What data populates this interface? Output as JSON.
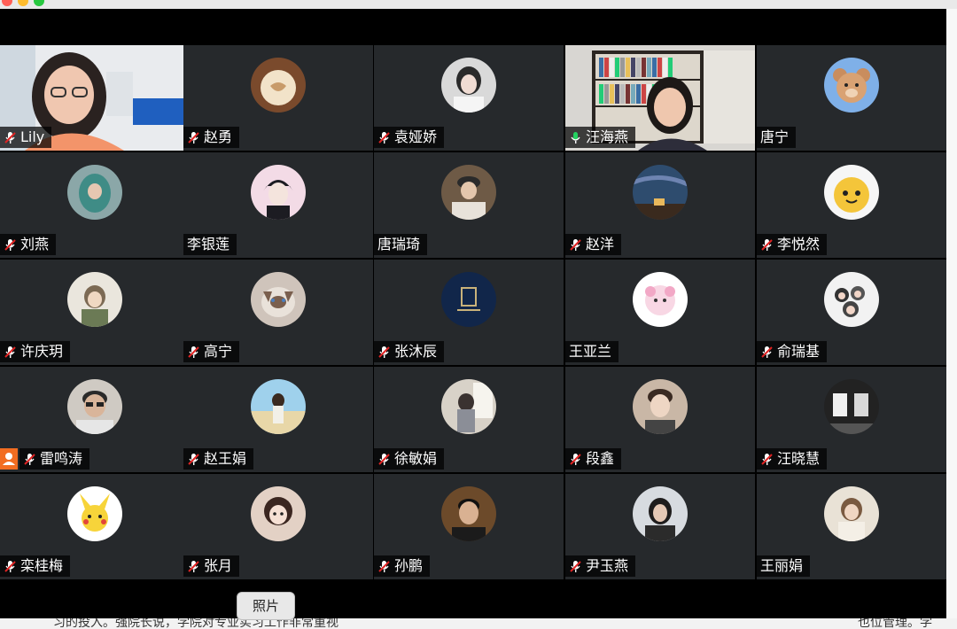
{
  "meeting": {
    "tooltip": "照片"
  },
  "participants": [
    {
      "name": "Lily",
      "muted": true,
      "video": "lily",
      "row": 0,
      "col": 0
    },
    {
      "name": "赵勇",
      "muted": true,
      "avatar": "coffee",
      "row": 0,
      "col": 1
    },
    {
      "name": "袁娅娇",
      "muted": true,
      "avatar": "girl-bw",
      "row": 0,
      "col": 2
    },
    {
      "name": "汪海燕",
      "muted": false,
      "speaking": true,
      "video": "bookshelf",
      "row": 0,
      "col": 3
    },
    {
      "name": "唐宁",
      "muted": false,
      "avatar": "bear",
      "row": 0,
      "col": 4
    },
    {
      "name": "刘燕",
      "muted": true,
      "avatar": "hood",
      "row": 1,
      "col": 0
    },
    {
      "name": "李银莲",
      "muted": false,
      "avatar": "anime-boy",
      "row": 1,
      "col": 1
    },
    {
      "name": "唐瑞琦",
      "muted": false,
      "avatar": "boy-cap",
      "row": 1,
      "col": 2
    },
    {
      "name": "赵洋",
      "muted": true,
      "avatar": "night-sky",
      "row": 1,
      "col": 3
    },
    {
      "name": "李悦然",
      "muted": true,
      "avatar": "cartoon-yellow",
      "row": 1,
      "col": 4
    },
    {
      "name": "许庆玥",
      "muted": true,
      "avatar": "cat-girl",
      "row": 2,
      "col": 0
    },
    {
      "name": "高宁",
      "muted": true,
      "avatar": "cat",
      "row": 2,
      "col": 1
    },
    {
      "name": "张沐辰",
      "muted": true,
      "avatar": "logo-navy",
      "row": 2,
      "col": 2
    },
    {
      "name": "王亚兰",
      "muted": false,
      "avatar": "pink-sheep",
      "row": 2,
      "col": 3
    },
    {
      "name": "俞瑞基",
      "muted": true,
      "avatar": "anime-group",
      "row": 2,
      "col": 4
    },
    {
      "name": "雷鸣涛",
      "muted": true,
      "host": true,
      "avatar": "glasses-man",
      "row": 3,
      "col": 0
    },
    {
      "name": "赵王娟",
      "muted": true,
      "avatar": "girl-beach",
      "row": 3,
      "col": 1
    },
    {
      "name": "徐敏娟",
      "muted": true,
      "avatar": "girl-window",
      "row": 3,
      "col": 2
    },
    {
      "name": "段鑫",
      "muted": true,
      "avatar": "boy-portrait",
      "row": 3,
      "col": 3
    },
    {
      "name": "汪晓慧",
      "muted": true,
      "avatar": "clothes",
      "row": 3,
      "col": 4
    },
    {
      "name": "栾桂梅",
      "muted": true,
      "avatar": "pikachu",
      "row": 4,
      "col": 0
    },
    {
      "name": "张月",
      "muted": true,
      "avatar": "doll-girl",
      "row": 4,
      "col": 1
    },
    {
      "name": "孙鹏",
      "muted": true,
      "avatar": "man-suit",
      "row": 4,
      "col": 2
    },
    {
      "name": "尹玉燕",
      "muted": true,
      "avatar": "woman-dark",
      "row": 4,
      "col": 3
    },
    {
      "name": "王丽娟",
      "muted": false,
      "avatar": "woman-hat",
      "row": 4,
      "col": 4
    }
  ],
  "colors": {
    "tile_bg": "#26292c",
    "speaking_border": "#23d160",
    "muted_red": "#e02424",
    "host_badge": "#f26d21"
  },
  "background_text": {
    "left": "习的投入。强院长说，学院对专业实习工作非常重视",
    "right": "也位管理。学"
  }
}
